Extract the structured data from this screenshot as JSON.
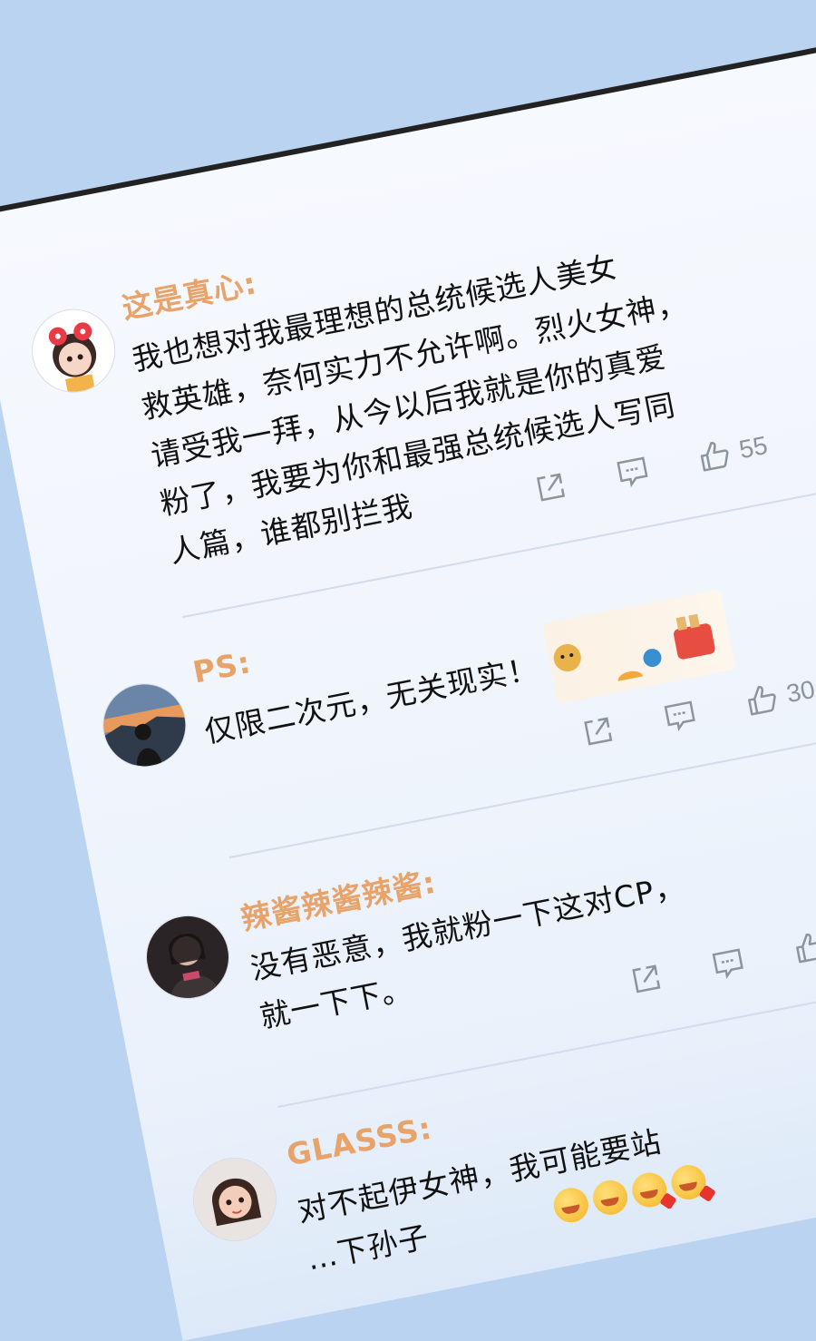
{
  "comments": [
    {
      "username": "这是真心:",
      "lines": [
        "我也想对我最理想的总统候选人美女",
        "救英雄，奈何实力不允许啊。烈火女神，",
        "请受我一拜，从今以后我就是你的真爱",
        "粉了，我要为你和最强总统候选人写同",
        "人篇，谁都别拦我"
      ],
      "likes": "55"
    },
    {
      "username": "PS:",
      "lines": [
        "仅限二次元，无关现实！"
      ],
      "likes": "30"
    },
    {
      "username": "辣酱辣酱辣酱:",
      "lines": [
        "没有恶意，我就粉一下这对CP，",
        "就一下下。"
      ],
      "likes": ""
    },
    {
      "username": "GLASSS:",
      "lines": [
        "对不起伊女神，我可能要站",
        "…下孙子"
      ],
      "likes": ""
    }
  ],
  "icons": {
    "share": "share-icon",
    "comment": "comment-icon",
    "like": "thumbs-up-icon"
  },
  "colors": {
    "sky": "#b9d3f1",
    "username": "#e8a36a",
    "text": "#111111",
    "icon": "#8d949e"
  }
}
